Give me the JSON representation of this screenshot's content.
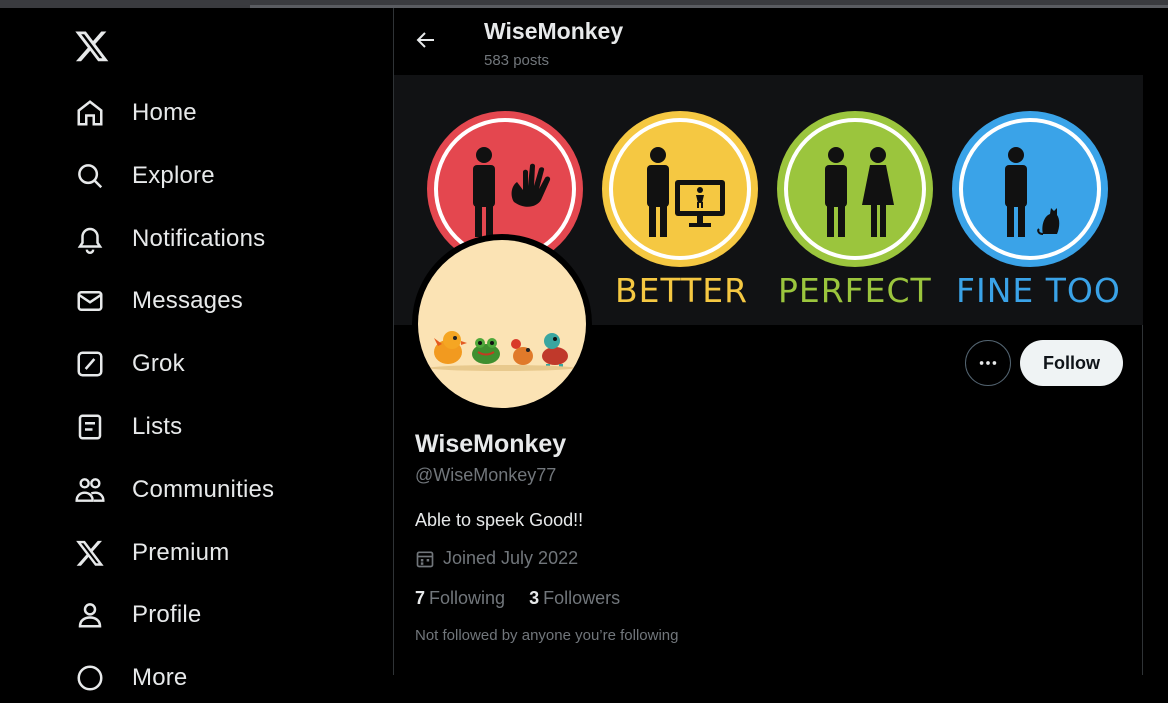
{
  "sidebar": {
    "logo": "x-logo-icon",
    "items": [
      {
        "label": "Home",
        "icon": "home-icon"
      },
      {
        "label": "Explore",
        "icon": "search-icon"
      },
      {
        "label": "Notifications",
        "icon": "bell-icon"
      },
      {
        "label": "Messages",
        "icon": "envelope-icon"
      },
      {
        "label": "Grok",
        "icon": "grok-icon"
      },
      {
        "label": "Lists",
        "icon": "list-icon"
      },
      {
        "label": "Communities",
        "icon": "people-icon"
      },
      {
        "label": "Premium",
        "icon": "x-logo-icon"
      },
      {
        "label": "Profile",
        "icon": "person-icon"
      },
      {
        "label": "More",
        "icon": "more-circle-icon"
      }
    ]
  },
  "header": {
    "title": "WiseMonkey",
    "post_count": "583 posts"
  },
  "banner": {
    "signs": [
      {
        "label": "",
        "color": "#e4474f"
      },
      {
        "label": "BETTER",
        "color": "#f5c842"
      },
      {
        "label": "PERFECT",
        "color": "#9bc53d"
      },
      {
        "label": "FINE TOO",
        "color": "#3aa3e8"
      }
    ]
  },
  "profile": {
    "name": "WiseMonkey",
    "handle": "@WiseMonkey77",
    "bio": "Able to speek Good!!",
    "joined": "Joined July 2022",
    "following_count": "7",
    "following_label": "Following",
    "followers_count": "3",
    "followers_label": "Followers",
    "note": "Not followed by anyone you’re following"
  },
  "actions": {
    "follow_label": "Follow"
  },
  "colors": {
    "background": "#000000",
    "text": "#e7e9ea",
    "muted": "#71767b",
    "border": "#2f3336"
  }
}
